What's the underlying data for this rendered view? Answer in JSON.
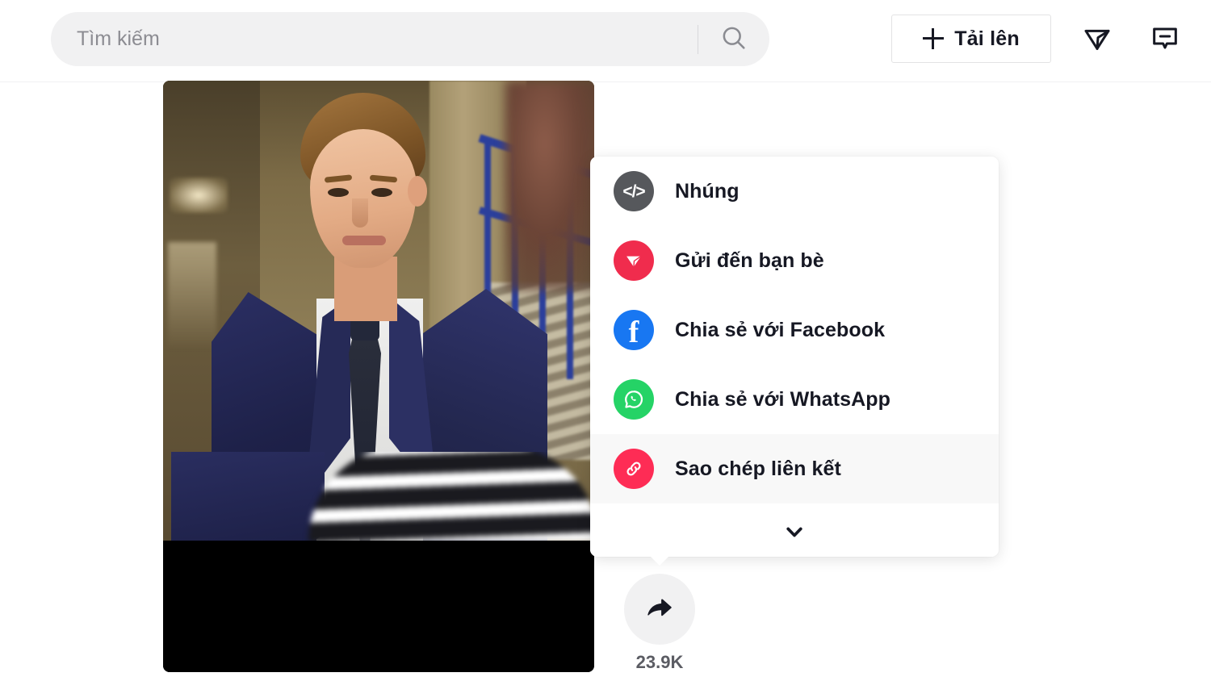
{
  "header": {
    "search": {
      "placeholder": "Tìm kiếm",
      "value": "",
      "search_icon": "search-icon"
    },
    "upload": {
      "label": "Tải lên",
      "plus_icon": "plus-icon"
    },
    "icons": {
      "inbox": "send-triangle-icon",
      "message": "message-bubble-icon"
    }
  },
  "video": {
    "alt": "man-in-navy-suit-video-thumbnail"
  },
  "share_menu": {
    "items": [
      {
        "label": "Nhúng",
        "icon": "code-embed-icon",
        "icon_color": "#56585c",
        "name": "share-item-embed",
        "active": false
      },
      {
        "label": "Gửi đến bạn bè",
        "icon": "paper-plane-icon",
        "icon_color": "#f02c4d",
        "name": "share-item-send-to-friends",
        "active": false
      },
      {
        "label": "Chia sẻ với Facebook",
        "icon": "facebook-icon",
        "icon_color": "#1877f2",
        "name": "share-item-facebook",
        "active": false
      },
      {
        "label": "Chia sẻ với WhatsApp",
        "icon": "whatsapp-icon",
        "icon_color": "#25d366",
        "name": "share-item-whatsapp",
        "active": false
      },
      {
        "label": "Sao chép liên kết",
        "icon": "link-chain-icon",
        "icon_color": "#fe2c55",
        "name": "share-item-copy-link",
        "active": true
      }
    ],
    "expand_icon": "chevron-down-icon"
  },
  "share_button": {
    "icon": "share-arrow-icon",
    "count": "23.9K"
  },
  "colors": {
    "accent_red": "#fe2c55",
    "send_red": "#f02c4d",
    "facebook_blue": "#1877f2",
    "whatsapp_green": "#25d366",
    "embed_gray": "#56585c",
    "text_primary": "#161823",
    "field_bg": "#f1f1f2",
    "row_hover": "#f8f8f8"
  }
}
